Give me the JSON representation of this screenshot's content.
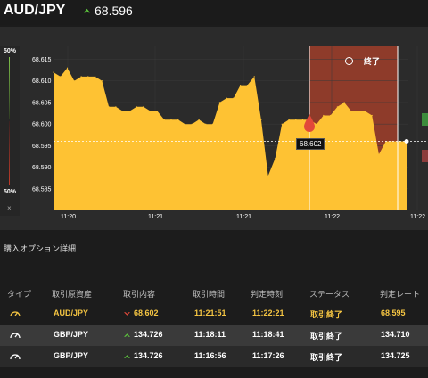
{
  "header": {
    "pair": "AUD/JPY",
    "price": "68.596",
    "price_direction": "up"
  },
  "side_panel": {
    "top_pct": "50%",
    "bottom_pct": "50%",
    "close": "×"
  },
  "chart": {
    "end_label": "終了",
    "current_badge": "68.602",
    "y_ticks": [
      "68.615",
      "68.610",
      "68.605",
      "68.600",
      "68.595",
      "68.590",
      "68.585"
    ],
    "x_ticks": [
      "11:20",
      "11:21",
      "11:21",
      "11:22",
      "11:22"
    ],
    "colors": {
      "area": "#fec233",
      "end_zone": "#8e3b2a",
      "grid": "#3a3a3a"
    }
  },
  "chart_data": {
    "type": "area",
    "title": "",
    "xlabel": "",
    "ylabel": "",
    "ylim": [
      68.58,
      68.618
    ],
    "x_ticks": [
      "11:20",
      "11:21",
      "11:21",
      "11:22",
      "11:22"
    ],
    "series": [
      {
        "values": [
          68.612,
          68.611,
          68.613,
          68.61,
          68.611,
          68.611,
          68.611,
          68.61,
          68.604,
          68.604,
          68.603,
          68.603,
          68.604,
          68.604,
          68.603,
          68.603,
          68.601,
          68.601,
          68.601,
          68.6,
          68.6,
          68.601,
          68.6,
          68.6,
          68.605,
          68.606,
          68.606,
          68.609,
          68.609,
          68.611,
          68.601,
          68.588,
          68.592,
          68.6,
          68.601,
          68.601,
          68.601,
          68.601,
          68.6,
          68.602,
          68.602,
          68.604,
          68.605,
          68.603,
          68.603,
          68.603,
          68.602,
          68.593,
          68.596,
          68.596,
          68.596,
          68.596
        ]
      }
    ]
  },
  "section_title": "購入オプション詳細",
  "table": {
    "headers": [
      "タイプ",
      "取引原資産",
      "取引内容",
      "取引時間",
      "判定時刻",
      "ステータス",
      "判定レート"
    ],
    "rows": [
      {
        "asset": "AUD/JPY",
        "direction": "down",
        "rate": "68.602",
        "time": "11:21:51",
        "judge": "11:22:21",
        "status": "取引終了",
        "result": "68.595"
      },
      {
        "asset": "GBP/JPY",
        "direction": "up",
        "rate": "134.726",
        "time": "11:18:11",
        "judge": "11:18:41",
        "status": "取引終了",
        "result": "134.710"
      },
      {
        "asset": "GBP/JPY",
        "direction": "up",
        "rate": "134.726",
        "time": "11:16:56",
        "judge": "11:17:26",
        "status": "取引終了",
        "result": "134.725"
      }
    ]
  }
}
